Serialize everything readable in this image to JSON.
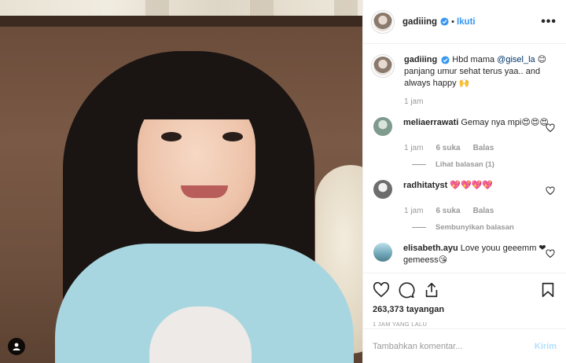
{
  "post": {
    "username": "gadiiing",
    "follow_label": "Ikuti",
    "more_label": "•••",
    "separator": "•"
  },
  "caption": {
    "username": "gadiiing",
    "text_pre": "Hbd mama ",
    "mention": "@gisel_la",
    "text_post": " 😊 panjang umur sehat terus yaa.. and always happy 🙌",
    "time": "1 jam"
  },
  "comments": [
    {
      "username": "meliaerrawati",
      "text": "Gemay nya mpi😍😍😍",
      "time": "1 jam",
      "likes": "6 suka",
      "reply": "Balas",
      "replies_label": "Lihat balasan (1)",
      "avatar_color": "#7f9a8e"
    },
    {
      "username": "radhitatyst",
      "text": "💖💖💖💖",
      "time": "1 jam",
      "likes": "6 suka",
      "reply": "Balas",
      "replies_label": "Sembunyikan balasan",
      "avatar_color": "#8c8c8c"
    },
    {
      "username": "elisabeth.ayu",
      "text": "Love youu geeemm ❤ gemeess😘",
      "avatar_color": "#6fa7b8"
    }
  ],
  "actions": {
    "views": "263,373 tayangan",
    "timestamp": "1 JAM YANG LALU"
  },
  "add_comment": {
    "placeholder": "Tambahkan komentar...",
    "post_label": "Kirim"
  },
  "icons": {
    "heart": "heart-icon",
    "comment": "comment-icon",
    "share": "share-icon",
    "save": "bookmark-icon",
    "verified": "verified-badge-icon",
    "user": "user-tag-icon"
  },
  "colors": {
    "link": "#3897f0",
    "post_disabled": "#b2dffc",
    "muted": "#999999",
    "mention": "#003569"
  }
}
